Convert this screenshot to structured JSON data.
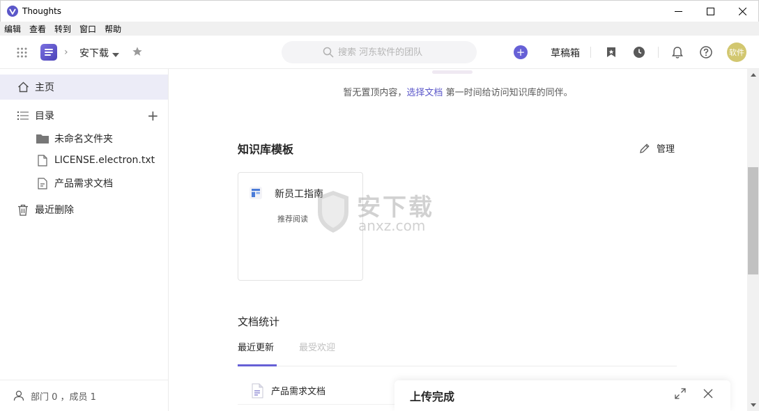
{
  "window": {
    "title": "Thoughts"
  },
  "menu": {
    "items": [
      "编辑",
      "查看",
      "转到",
      "窗口",
      "帮助"
    ]
  },
  "header": {
    "space_name": "安下载",
    "search_placeholder": "搜索 河东软件的团队",
    "drafts_label": "草稿箱",
    "avatar_text": "软件",
    "accent_color": "#6660d6"
  },
  "sidebar": {
    "home_label": "主页",
    "catalog_label": "目录",
    "items": [
      {
        "label": "未命名文件夹",
        "icon": "folder-icon"
      },
      {
        "label": "LICENSE.electron.txt",
        "icon": "file-icon"
      },
      {
        "label": "产品需求文档",
        "icon": "document-icon"
      }
    ],
    "trash_label": "最近删除",
    "footer_text": "部门 0 ，成员 1"
  },
  "main": {
    "empty_pin": {
      "prefix": "暂无置顶内容，",
      "link": "选择文档",
      "suffix": " 第一时间给访问知识库的同伴。"
    },
    "templates_title": "知识库模板",
    "manage_label": "管理",
    "template_card": {
      "title": "新员工指南",
      "subtitle": "推荐阅读"
    },
    "stats_title": "文档统计",
    "tabs": [
      {
        "label": "最近更新",
        "active": true
      },
      {
        "label": "最受欢迎",
        "active": false
      }
    ],
    "doc_rows": [
      {
        "title": "产品需求文档"
      }
    ]
  },
  "watermark": {
    "text_cn": "安下载",
    "text_en": "anxz.com"
  },
  "upload": {
    "title": "上传完成"
  }
}
